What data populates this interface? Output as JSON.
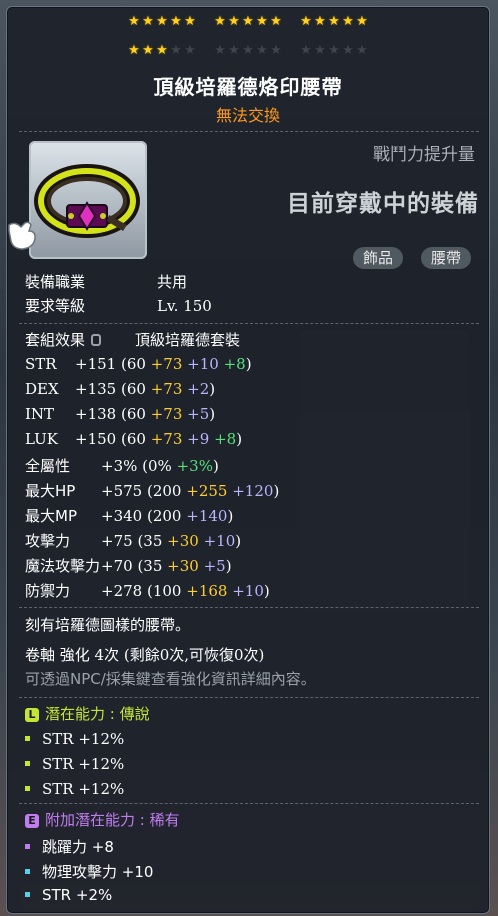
{
  "stars": {
    "row1": [
      5,
      5,
      5
    ],
    "row2_filled": [
      3,
      0,
      0
    ],
    "row2_total": [
      5,
      5,
      5
    ]
  },
  "item": {
    "name": "頂級培羅德烙印腰帶",
    "trade_status": "無法交換",
    "icon": "belt-icon"
  },
  "battle_power_label": "戰鬥力提升量",
  "equipped_label": "目前穿戴中的裝備",
  "tags": [
    "飾品",
    "腰帶"
  ],
  "req": {
    "job_label": "裝備職業",
    "job_value": "共用",
    "level_label": "要求等級",
    "level_value": "Lv. 150"
  },
  "set": {
    "label": "套組效果",
    "name": "頂級培羅德套裝"
  },
  "stats": [
    {
      "label": "STR",
      "total": "+151",
      "open": "(60",
      "parts": [
        {
          "t": "+73",
          "c": "y"
        },
        {
          "t": "+10",
          "c": "p"
        },
        {
          "t": "+8",
          "c": "g"
        }
      ],
      "close": ")"
    },
    {
      "label": "DEX",
      "total": "+135",
      "open": "(60",
      "parts": [
        {
          "t": "+73",
          "c": "y"
        },
        {
          "t": "+2",
          "c": "p"
        }
      ],
      "close": ")"
    },
    {
      "label": "INT",
      "total": "+138",
      "open": "(60",
      "parts": [
        {
          "t": "+73",
          "c": "y"
        },
        {
          "t": "+5",
          "c": "p"
        }
      ],
      "close": ")"
    },
    {
      "label": "LUK",
      "total": "+150",
      "open": "(60",
      "parts": [
        {
          "t": "+73",
          "c": "y"
        },
        {
          "t": "+9",
          "c": "p"
        },
        {
          "t": "+8",
          "c": "g"
        }
      ],
      "close": ")"
    },
    {
      "label": "全屬性",
      "total": "+3%",
      "open": "(0%",
      "parts": [
        {
          "t": "+3%",
          "c": "g"
        }
      ],
      "close": ")"
    },
    {
      "label": "最大HP",
      "total": "+575",
      "open": "(200",
      "parts": [
        {
          "t": "+255",
          "c": "y"
        },
        {
          "t": "+120",
          "c": "p"
        }
      ],
      "close": ")"
    },
    {
      "label": "最大MP",
      "total": "+340",
      "open": "(200",
      "parts": [
        {
          "t": "+140",
          "c": "p"
        }
      ],
      "close": ")"
    },
    {
      "label": "攻擊力",
      "total": "+75",
      "open": "(35",
      "parts": [
        {
          "t": "+30",
          "c": "y"
        },
        {
          "t": "+10",
          "c": "p"
        }
      ],
      "close": ")"
    },
    {
      "label": "魔法攻擊力",
      "total": "+70",
      "open": "(35",
      "parts": [
        {
          "t": "+30",
          "c": "y"
        },
        {
          "t": "+5",
          "c": "p"
        }
      ],
      "close": ")"
    },
    {
      "label": "防禦力",
      "total": "+278",
      "open": "(100",
      "parts": [
        {
          "t": "+168",
          "c": "y"
        },
        {
          "t": "+10",
          "c": "p"
        }
      ],
      "close": ")"
    }
  ],
  "description": "刻有培羅德圖樣的腰帶。",
  "scroll_line": "卷軸 強化 4次 (剩餘0次,可恢復0次)",
  "scroll_hint": "可透過NPC/採集鍵查看強化資訊詳細內容。",
  "potential": {
    "badge": "L",
    "label": "潛在能力",
    "sep": ":",
    "grade": "傳說",
    "color": "#c6e533",
    "lines": [
      "STR +12%",
      "STR +12%",
      "STR +12%"
    ]
  },
  "additional": {
    "badge": "E",
    "label": "附加潛在能力",
    "sep": ":",
    "grade": "稀有",
    "color": "#c07df0",
    "lines": [
      {
        "text": "跳躍力 +8",
        "color": "#c07df0"
      },
      {
        "text": "物理攻擊力 +10",
        "color": "#5ad0e8"
      },
      {
        "text": "STR +2%",
        "color": "#5ad0e8"
      }
    ]
  }
}
